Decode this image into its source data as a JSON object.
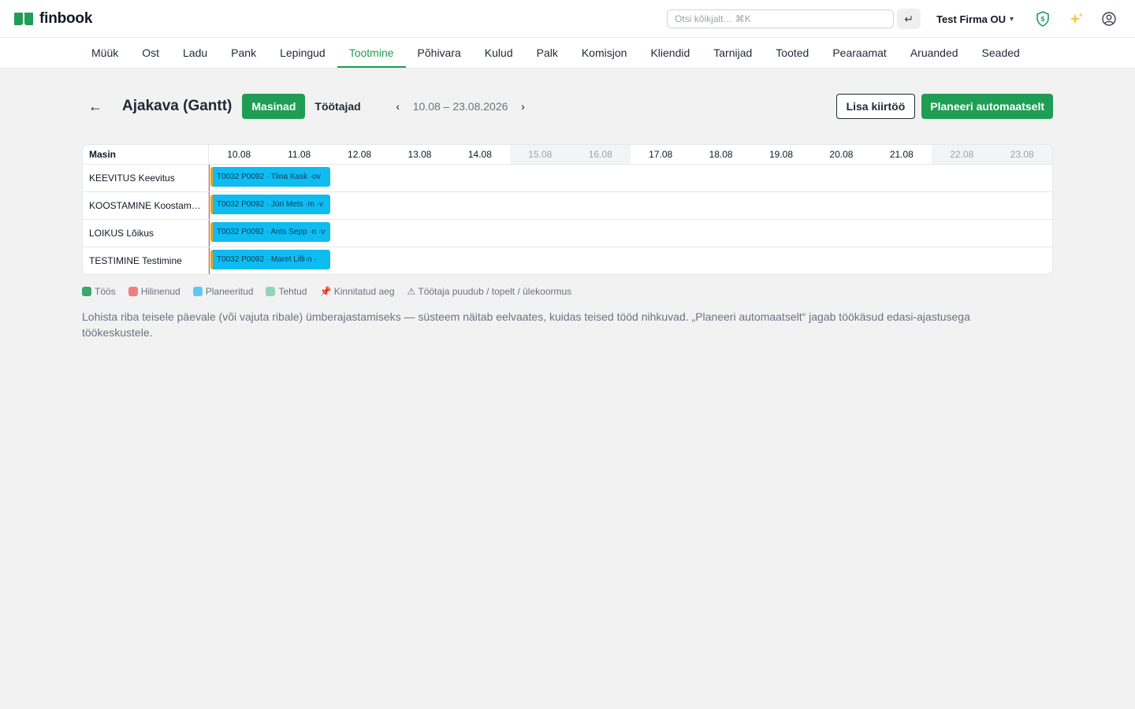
{
  "app": {
    "name": "finbook"
  },
  "topbar": {
    "search_placeholder": "Otsi kõikjalt…  ⌘K",
    "enter_icon": "↵",
    "company": "Test Firma OU",
    "company_chevron": "⌵",
    "icons": [
      "shield-icon",
      "sparkle-icon",
      "user-icon"
    ]
  },
  "nav": {
    "items": [
      "Müük",
      "Ost",
      "Ladu",
      "Pank",
      "Lepingud",
      "Tootmine",
      "Põhivara",
      "Kulud",
      "Palk",
      "Komisjon",
      "Kliendid",
      "Tarnijad",
      "Tooted",
      "Pearaamat",
      "Aruanded",
      "Seaded"
    ],
    "active": "Tootmine"
  },
  "header": {
    "back": "←",
    "title": "Ajakava (Gantt)",
    "view_active": "Masinad",
    "view_inactive": "Töötajad",
    "prev": "‹",
    "date_range": "10.08 – 23.08.2026",
    "next": "›",
    "add_urgent": "Lisa kiirtöö",
    "auto_plan": "Planeeri automaatselt"
  },
  "gantt": {
    "label_header": "Masin",
    "days": [
      {
        "label": "10.08",
        "weekend": false
      },
      {
        "label": "11.08",
        "weekend": false
      },
      {
        "label": "12.08",
        "weekend": false
      },
      {
        "label": "13.08",
        "weekend": false
      },
      {
        "label": "14.08",
        "weekend": false
      },
      {
        "label": "15.08",
        "weekend": true
      },
      {
        "label": "16.08",
        "weekend": true
      },
      {
        "label": "17.08",
        "weekend": false
      },
      {
        "label": "18.08",
        "weekend": false
      },
      {
        "label": "19.08",
        "weekend": false
      },
      {
        "label": "20.08",
        "weekend": false
      },
      {
        "label": "21.08",
        "weekend": false
      },
      {
        "label": "22.08",
        "weekend": true
      },
      {
        "label": "23.08",
        "weekend": true
      }
    ],
    "rows": [
      {
        "machine": "KEEVITUS Keevitus",
        "bar": "T0032 P0092 · Tiina Kask ·ov"
      },
      {
        "machine": "KOOSTAMINE Koostam…",
        "bar": "T0032 P0092 · Jüri Mets ·m ·v"
      },
      {
        "machine": "LOIKUS Lõikus",
        "bar": "T0032 P0092 · Ants Sepp ·n ·v"
      },
      {
        "machine": "TESTIMINE Testimine",
        "bar": "T0032 P0092 · Maret Lilli·n ·"
      }
    ]
  },
  "legend": [
    {
      "label": "Töös",
      "color": "#3aa76d",
      "kind": "swatch"
    },
    {
      "label": "Hilinenud",
      "color": "#f08080",
      "kind": "swatch"
    },
    {
      "label": "Planeeritud",
      "color": "#5ec8f5",
      "kind": "swatch"
    },
    {
      "label": "Tehtud",
      "color": "#8fd6b5",
      "kind": "swatch"
    },
    {
      "label": "📌 Kinnitatud aeg",
      "kind": "text"
    },
    {
      "label": "⚠ Töötaja puudub / topelt / ülekoormus",
      "kind": "text"
    }
  ],
  "help_text": "Lohista riba teisele päevale (või vajuta ribale) ümberajastamiseks — süsteem näitab eelvaates, kuidas teised tööd nihkuvad. „Planeeri automaatselt“ jagab töökäsud edasi-ajastusega töökeskustele."
}
